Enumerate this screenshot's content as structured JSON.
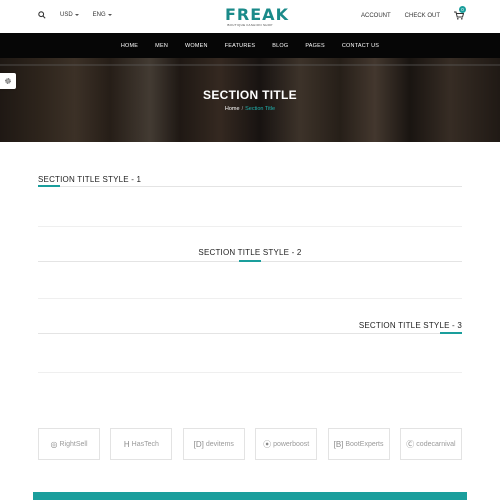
{
  "topbar": {
    "currency": "USD",
    "language": "ENG",
    "account": "ACCOUNT",
    "checkout": "CHECK OUT",
    "cart_count": "0"
  },
  "logo": {
    "name": "FREAK",
    "tagline": "BOUTIQUE FASHION SHOP"
  },
  "nav": {
    "items": [
      "HOME",
      "MEN",
      "WOMEN",
      "FEATURES",
      "BLOG",
      "PAGES",
      "CONTACT US"
    ]
  },
  "hero": {
    "title": "SECTION TITLE",
    "breadcrumb": {
      "home": "Home",
      "separator": "/",
      "current": "Section Title"
    }
  },
  "sections": [
    {
      "title": "SECTION TITLE STYLE - 1",
      "align": "left"
    },
    {
      "title": "SECTION TITLE STYLE - 2",
      "align": "center"
    },
    {
      "title": "SECTION TITLE STYLE - 3",
      "align": "right"
    }
  ],
  "brands": [
    {
      "name": "RightSell",
      "icon": "rightsell-logo"
    },
    {
      "name": "HasTech",
      "icon": "hastech-logo"
    },
    {
      "name": "devitems",
      "icon": "devitems-logo"
    },
    {
      "name": "powerboost",
      "icon": "powerboost-logo"
    },
    {
      "name": "BootExperts",
      "icon": "bootexperts-logo"
    },
    {
      "name": "codecarnival",
      "icon": "codecarnival-logo"
    }
  ],
  "colors": {
    "accent": "#1a9e9c",
    "nav_bg": "#060606"
  }
}
